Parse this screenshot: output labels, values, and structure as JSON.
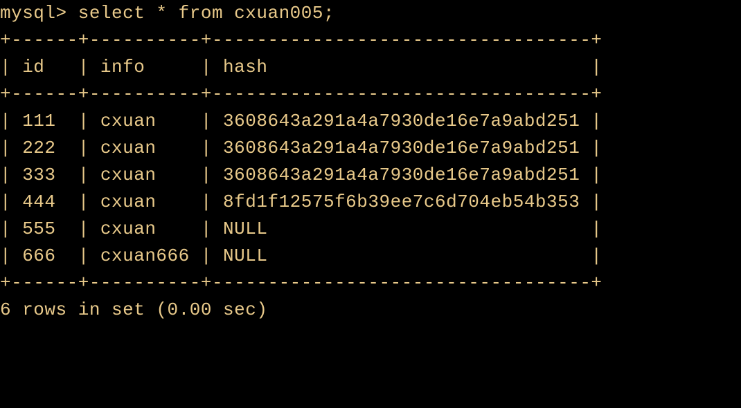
{
  "prompt": "mysql>",
  "command": "select * from cxuan005;",
  "border_top": "+------+----------+----------------------------------+",
  "border_mid": "+------+----------+----------------------------------+",
  "border_bottom": "+------+----------+----------------------------------+",
  "headers": {
    "id": "id",
    "info": "info",
    "hash": "hash"
  },
  "rows": [
    {
      "id": "111",
      "info": "cxuan",
      "hash": "3608643a291a4a7930de16e7a9abd251"
    },
    {
      "id": "222",
      "info": "cxuan",
      "hash": "3608643a291a4a7930de16e7a9abd251"
    },
    {
      "id": "333",
      "info": "cxuan",
      "hash": "3608643a291a4a7930de16e7a9abd251"
    },
    {
      "id": "444",
      "info": "cxuan",
      "hash": "8fd1f12575f6b39ee7c6d704eb54b353"
    },
    {
      "id": "555",
      "info": "cxuan",
      "hash": "NULL"
    },
    {
      "id": "666",
      "info": "cxuan666",
      "hash": "NULL"
    }
  ],
  "status": "6 rows in set (0.00 sec)",
  "widths": {
    "id": 4,
    "info": 8,
    "hash": 32
  }
}
